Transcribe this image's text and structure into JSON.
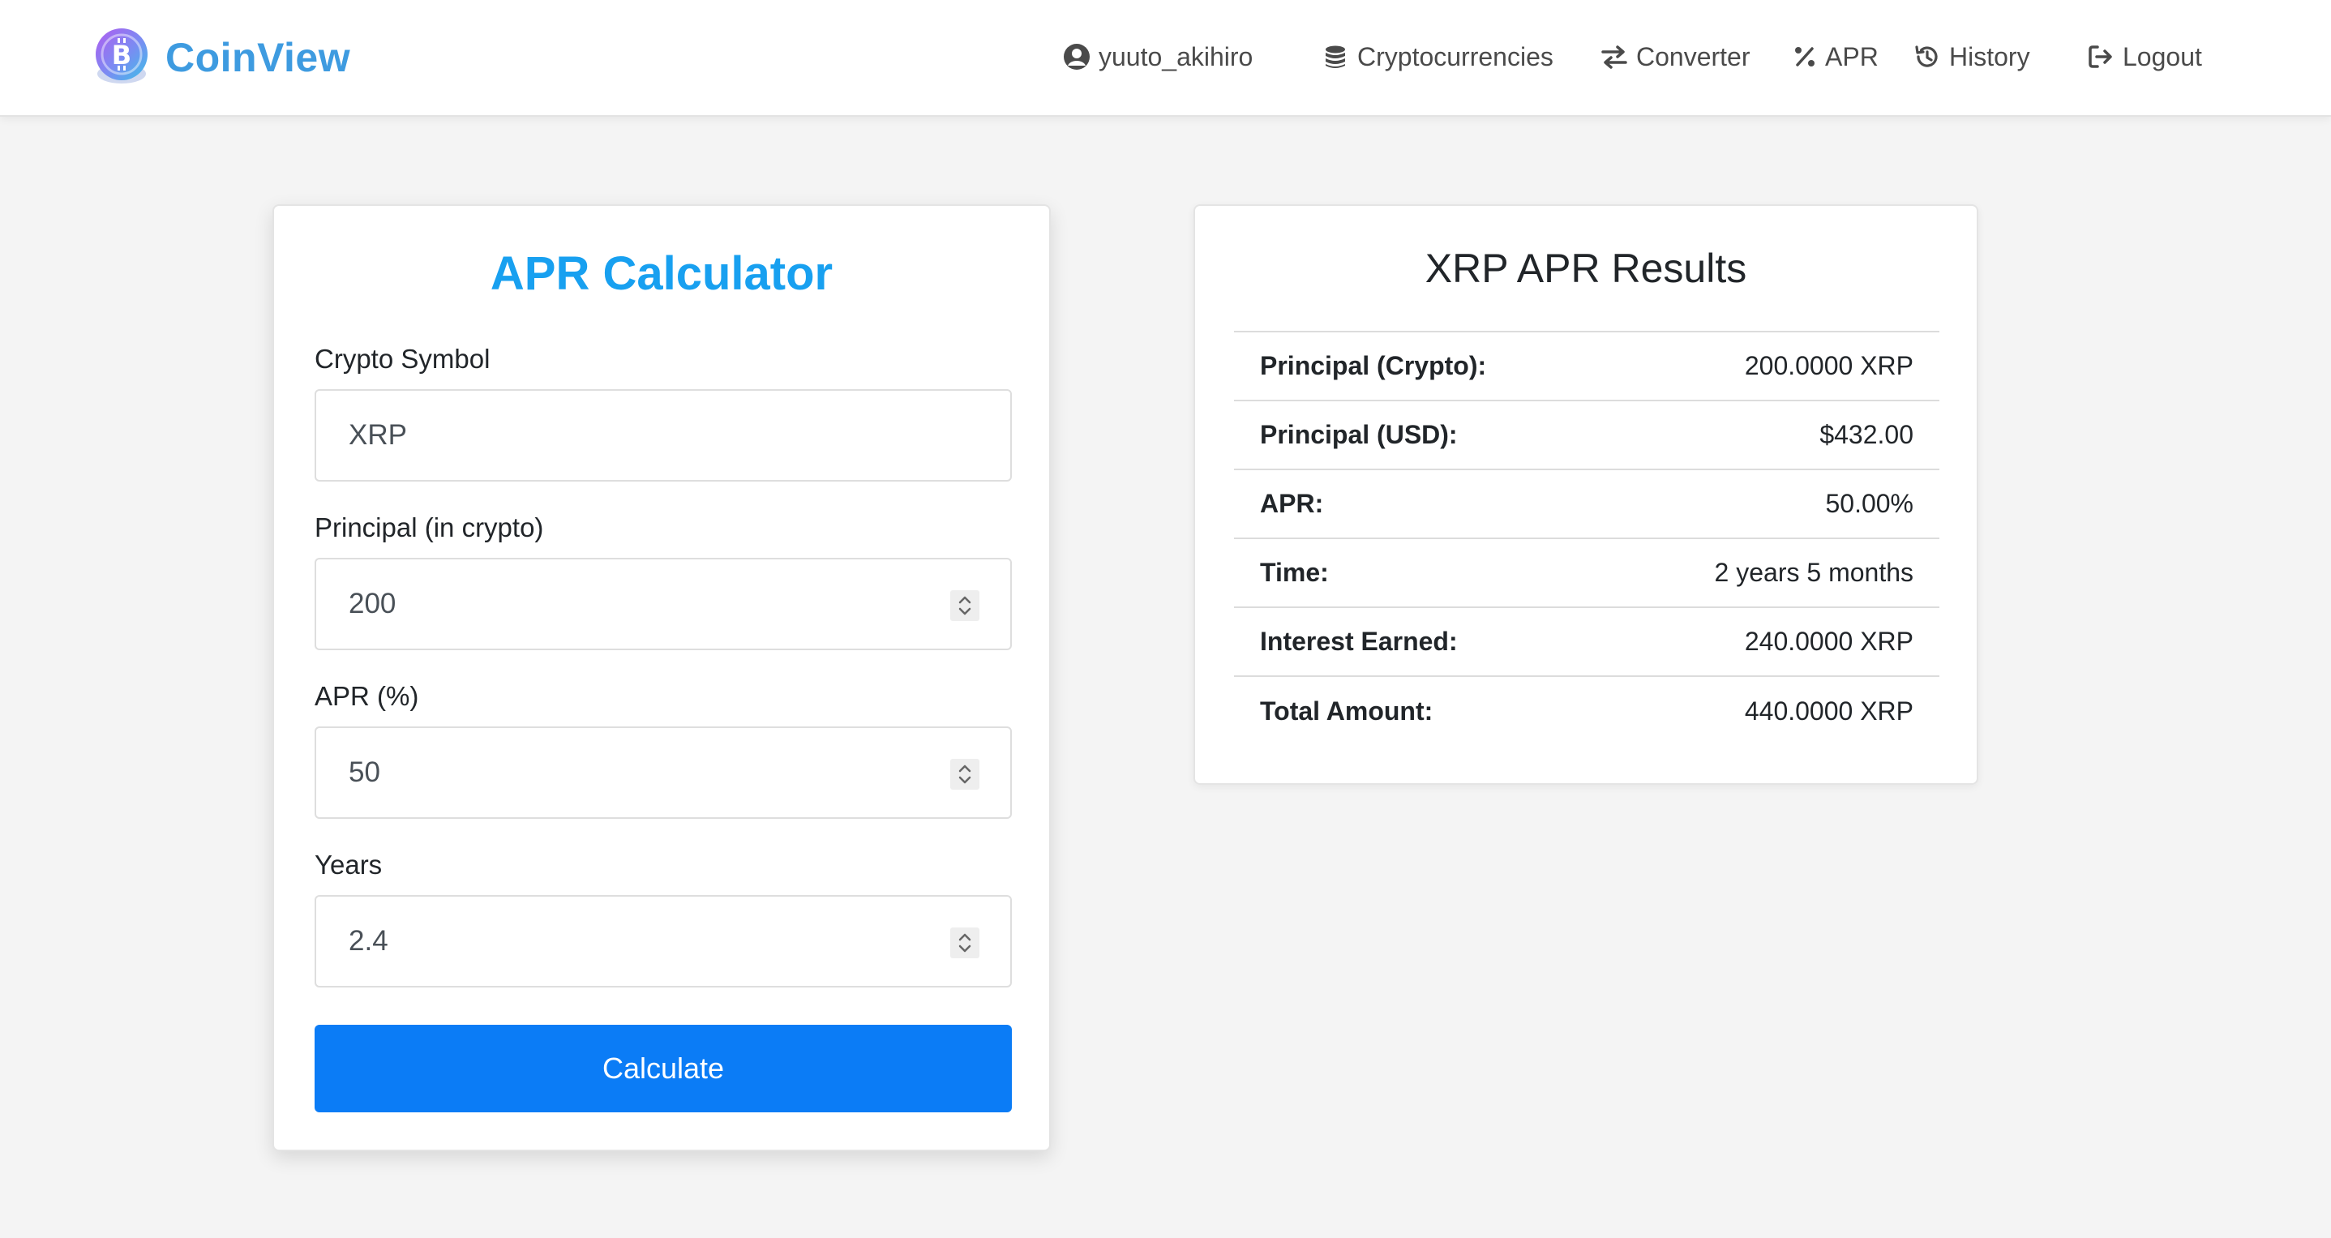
{
  "brand": {
    "name": "CoinView",
    "logo_icon": "bitcoin-coin-icon"
  },
  "nav": {
    "user": {
      "label": "yuuto_akihiro",
      "icon": "user-circle-icon"
    },
    "items": [
      {
        "label": "Cryptocurrencies",
        "icon": "coins-icon"
      },
      {
        "label": "Converter",
        "icon": "exchange-arrows-icon"
      },
      {
        "label": "APR",
        "icon": "percent-icon"
      },
      {
        "label": "History",
        "icon": "history-icon"
      },
      {
        "label": "Logout",
        "icon": "logout-icon"
      }
    ]
  },
  "calculator": {
    "title": "APR Calculator",
    "fields": [
      {
        "label": "Crypto Symbol",
        "value": "XRP",
        "type": "text"
      },
      {
        "label": "Principal (in crypto)",
        "value": "200",
        "type": "number"
      },
      {
        "label": "APR (%)",
        "value": "50",
        "type": "number"
      },
      {
        "label": "Years",
        "value": "2.4",
        "type": "number"
      }
    ],
    "button_label": "Calculate"
  },
  "results": {
    "title": "XRP APR Results",
    "rows": [
      {
        "label": "Principal (Crypto):",
        "value": "200.0000 XRP"
      },
      {
        "label": "Principal (USD):",
        "value": "$432.00"
      },
      {
        "label": "APR:",
        "value": "50.00%"
      },
      {
        "label": "Time:",
        "value": "2 years 5 months"
      },
      {
        "label": "Interest Earned:",
        "value": "240.0000 XRP"
      },
      {
        "label": "Total Amount:",
        "value": "440.0000 XRP"
      }
    ]
  },
  "colors": {
    "brand": "#3e9be0",
    "title_accent": "#18a0f0",
    "primary_button": "#0b7cf6",
    "page_background": "#f4f4f4"
  }
}
